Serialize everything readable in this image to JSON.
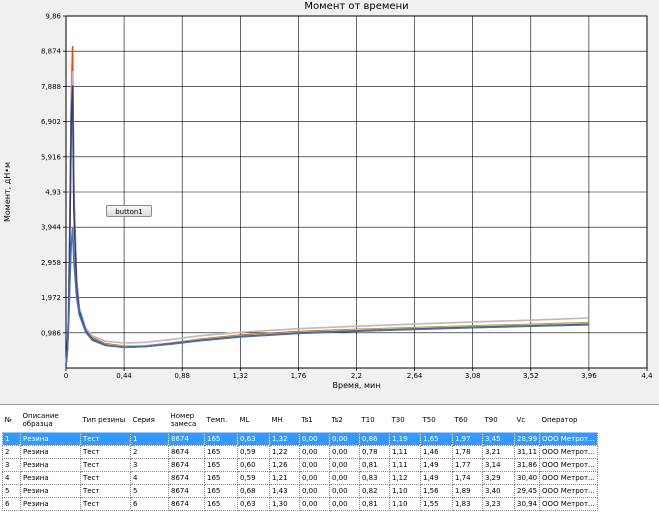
{
  "chart": {
    "button_label": "button1"
  },
  "chart_data": {
    "type": "line",
    "title": "Момент от времени",
    "xlabel": "Время, мин",
    "ylabel": "Момент, дН•м",
    "xlim": [
      0,
      4.4
    ],
    "ylim": [
      0,
      9.86
    ],
    "xticks": [
      "0",
      "0,44",
      "0,88",
      "1,32",
      "1,76",
      "2,2",
      "2,64",
      "3,08",
      "3,52",
      "3,96",
      "4,4"
    ],
    "yticks": [
      "0,986",
      "1,972",
      "2,958",
      "3,944",
      "4,93",
      "5,916",
      "6,902",
      "7,888",
      "8,874",
      "9,86"
    ],
    "grid": true,
    "series": [
      {
        "color": "#e8491d",
        "x": [
          0,
          0.01,
          0.02,
          0.03,
          0.04,
          0.05,
          0.06,
          0.08,
          0.1,
          0.15,
          0.2,
          0.3,
          0.44,
          0.6,
          0.8,
          1.0,
          1.32,
          1.76,
          2.2,
          2.64,
          3.08,
          3.52,
          3.96
        ],
        "y": [
          0.05,
          0.5,
          1.5,
          4.5,
          7.5,
          9.0,
          5.0,
          2.5,
          1.7,
          1.1,
          0.85,
          0.68,
          0.61,
          0.62,
          0.7,
          0.8,
          0.92,
          1.02,
          1.08,
          1.13,
          1.18,
          1.22,
          1.27
        ]
      },
      {
        "color": "#c8c832",
        "x": [
          0,
          0.01,
          0.02,
          0.03,
          0.04,
          0.05,
          0.06,
          0.08,
          0.1,
          0.15,
          0.2,
          0.3,
          0.44,
          0.6,
          0.8,
          1.0,
          1.32,
          1.76,
          2.2,
          2.64,
          3.08,
          3.52,
          3.96
        ],
        "y": [
          0.05,
          0.5,
          1.4,
          4.0,
          7.0,
          8.0,
          4.5,
          2.3,
          1.6,
          1.05,
          0.82,
          0.66,
          0.6,
          0.61,
          0.69,
          0.79,
          0.9,
          1.0,
          1.07,
          1.12,
          1.17,
          1.21,
          1.26
        ]
      },
      {
        "color": "#b8b8c8",
        "x": [
          0,
          0.01,
          0.02,
          0.03,
          0.04,
          0.05,
          0.06,
          0.08,
          0.1,
          0.15,
          0.2,
          0.3,
          0.44,
          0.6,
          0.8,
          1.0,
          1.32,
          1.76,
          2.2,
          2.64,
          3.08,
          3.52,
          3.96
        ],
        "y": [
          0.05,
          0.5,
          1.5,
          4.2,
          7.2,
          8.3,
          4.6,
          2.4,
          1.7,
          1.12,
          0.9,
          0.75,
          0.7,
          0.72,
          0.8,
          0.9,
          1.0,
          1.1,
          1.17,
          1.23,
          1.29,
          1.34,
          1.4
        ]
      },
      {
        "color": "#2d3f7a",
        "x": [
          0,
          0.01,
          0.02,
          0.03,
          0.04,
          0.05,
          0.06,
          0.08,
          0.1,
          0.15,
          0.2,
          0.3,
          0.44,
          0.6,
          0.8,
          1.0,
          1.32,
          1.76,
          2.2,
          2.64,
          3.08,
          3.52,
          3.96
        ],
        "y": [
          0.05,
          0.5,
          1.4,
          4.1,
          7.1,
          7.9,
          4.4,
          2.3,
          1.6,
          1.04,
          0.8,
          0.64,
          0.58,
          0.6,
          0.68,
          0.77,
          0.88,
          0.98,
          1.04,
          1.09,
          1.14,
          1.18,
          1.22
        ]
      },
      {
        "color": "#4a6fb5",
        "x": [
          0,
          0.01,
          0.02,
          0.03,
          0.04,
          0.05,
          0.06,
          0.08,
          0.1,
          0.15,
          0.2,
          0.3,
          0.44,
          0.6,
          0.8,
          1.0,
          1.32,
          1.76,
          2.2,
          2.64,
          3.08,
          3.52,
          3.96
        ],
        "y": [
          0.05,
          0.4,
          1.2,
          2.5,
          3.5,
          3.9,
          3.0,
          2.0,
          1.5,
          1.0,
          0.78,
          0.63,
          0.58,
          0.6,
          0.67,
          0.76,
          0.87,
          0.97,
          1.03,
          1.08,
          1.13,
          1.17,
          1.21
        ]
      }
    ]
  },
  "table": {
    "columns": [
      "№",
      "Описание образца",
      "Тип резины",
      "Серия",
      "Номер замеса",
      "Темп.",
      "ML",
      "MH",
      "Ts1",
      "Ts2",
      "T10",
      "T30",
      "T50",
      "T60",
      "T90",
      "Vc",
      "Оператор"
    ],
    "rows": [
      [
        "1",
        "Резина",
        "Тест",
        "1",
        "8674",
        "165",
        "0,63",
        "1,32",
        "0,00",
        "0,00",
        "0,86",
        "1,19",
        "1,65",
        "1,97",
        "3,45",
        "28,99",
        "ООО Метрот..."
      ],
      [
        "2",
        "Резина",
        "Тест",
        "2",
        "8674",
        "165",
        "0,59",
        "1,22",
        "0,00",
        "0,00",
        "0,78",
        "1,11",
        "1,46",
        "1,78",
        "3,21",
        "31,11",
        "ООО Метрот..."
      ],
      [
        "3",
        "Резина",
        "Тест",
        "3",
        "8674",
        "165",
        "0,60",
        "1,26",
        "0,00",
        "0,00",
        "0,81",
        "1,11",
        "1,49",
        "1,77",
        "3,14",
        "31,86",
        "ООО Метрот..."
      ],
      [
        "4",
        "Резина",
        "Тест",
        "4",
        "8674",
        "165",
        "0,59",
        "1,21",
        "0,00",
        "0,00",
        "0,83",
        "1,12",
        "1,49",
        "1,74",
        "3,29",
        "30,40",
        "ООО Метрот..."
      ],
      [
        "5",
        "Резина",
        "Тест",
        "5",
        "8674",
        "165",
        "0,68",
        "1,43",
        "0,00",
        "0,00",
        "0,82",
        "1,10",
        "1,56",
        "1,89",
        "3,40",
        "29,45",
        "ООО Метрот..."
      ],
      [
        "6",
        "Резина",
        "Тест",
        "6",
        "8674",
        "165",
        "0,63",
        "1,30",
        "0,00",
        "0,00",
        "0,81",
        "1,10",
        "1,55",
        "1,83",
        "3,23",
        "30,94",
        "ООО Метрот..."
      ]
    ],
    "selected_row": 0
  }
}
